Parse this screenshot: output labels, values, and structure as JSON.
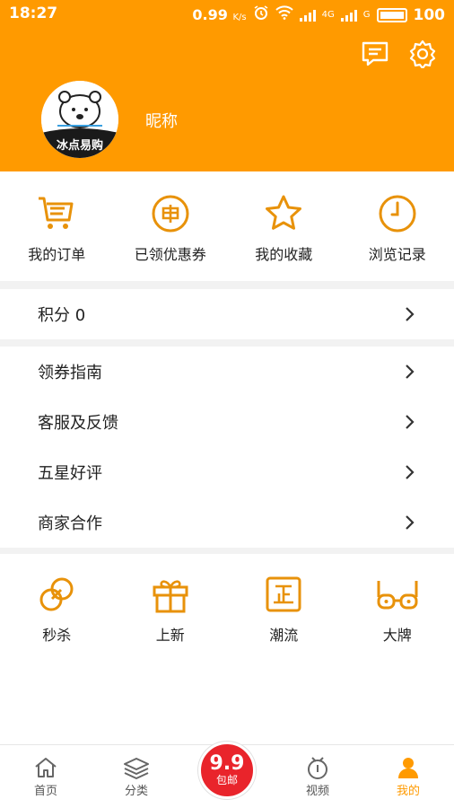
{
  "status_bar": {
    "time": "18:27",
    "speed": "0.99",
    "speed_unit": "K/s",
    "network_4g": "4G",
    "network_g": "G",
    "battery": "100"
  },
  "header": {
    "nickname": "昵称",
    "avatar_logo_text": "冰点易购",
    "icons": [
      "message-icon",
      "gear-icon"
    ]
  },
  "quick_actions": [
    {
      "label": "我的订单",
      "icon": "cart-icon"
    },
    {
      "label": "已领优惠券",
      "icon": "coupon-icon"
    },
    {
      "label": "我的收藏",
      "icon": "star-icon"
    },
    {
      "label": "浏览记录",
      "icon": "clock-icon"
    }
  ],
  "points_row": {
    "label": "积分 0"
  },
  "menu_rows": [
    {
      "label": "领券指南"
    },
    {
      "label": "客服及反馈"
    },
    {
      "label": "五星好评"
    },
    {
      "label": "商家合作"
    }
  ],
  "promo_items": [
    {
      "label": "秒杀",
      "icon": "link-icon"
    },
    {
      "label": "上新",
      "icon": "gift-icon"
    },
    {
      "label": "潮流",
      "icon": "zheng-icon"
    },
    {
      "label": "大牌",
      "icon": "glasses-icon"
    }
  ],
  "bottom_nav": {
    "items": [
      {
        "label": "首页",
        "icon": "home-icon"
      },
      {
        "label": "分类",
        "icon": "layers-icon"
      },
      {
        "label": "视频",
        "icon": "video-icon"
      },
      {
        "label": "我的",
        "icon": "user-icon"
      }
    ],
    "center": {
      "top": "9.9",
      "bottom": "包邮"
    }
  },
  "colors": {
    "accent": "#ff9a00",
    "center_button": "#e9242b"
  }
}
